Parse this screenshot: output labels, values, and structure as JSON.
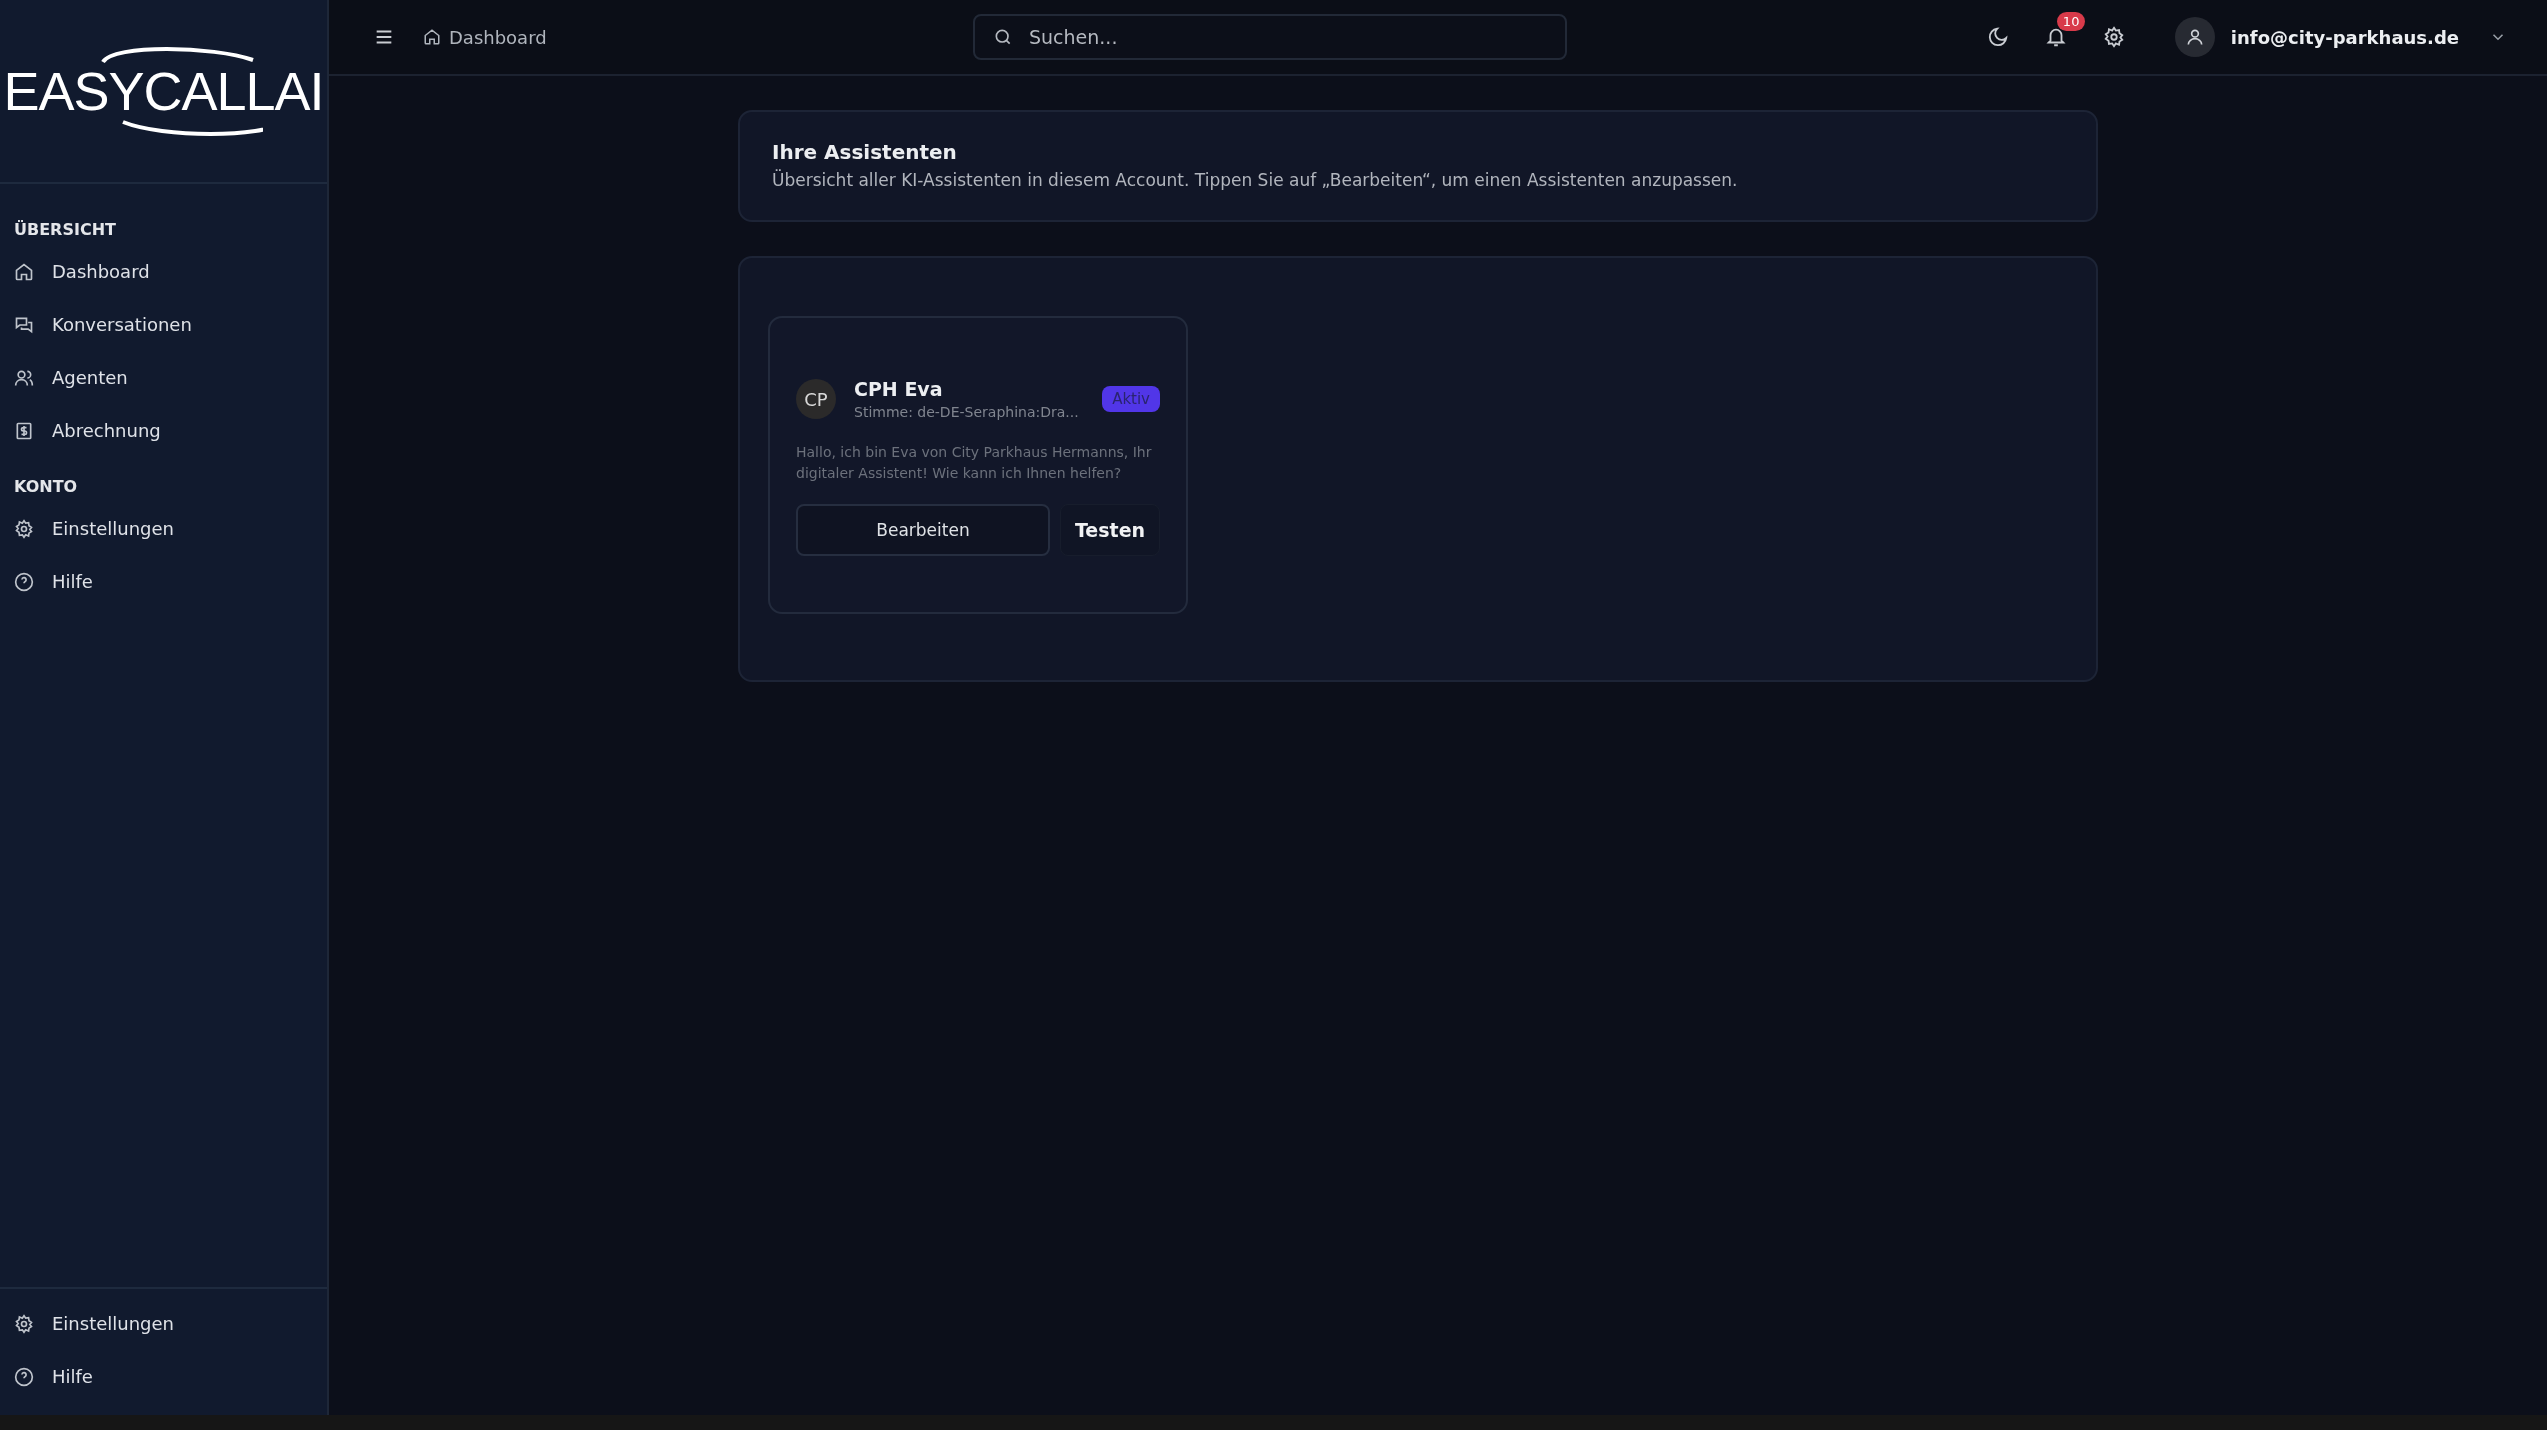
{
  "logo": {
    "text": "EASYCALLAI"
  },
  "sidebar": {
    "sections": [
      {
        "heading": "ÜBERSICHT",
        "items": [
          {
            "label": "Dashboard",
            "kind": "home"
          },
          {
            "label": "Konversationen",
            "kind": "chat"
          },
          {
            "label": "Agenten",
            "kind": "users"
          },
          {
            "label": "Abrechnung",
            "kind": "billing"
          }
        ]
      },
      {
        "heading": "KONTO",
        "items": [
          {
            "label": "Einstellungen",
            "kind": "settings"
          },
          {
            "label": "Hilfe",
            "kind": "help"
          }
        ]
      }
    ],
    "footer_items": [
      {
        "label": "Einstellungen",
        "kind": "settings"
      },
      {
        "label": "Hilfe",
        "kind": "help"
      }
    ]
  },
  "topbar": {
    "breadcrumb": "Dashboard",
    "search": {
      "placeholder": "Suchen..."
    },
    "notification_count": "10",
    "user_email": "info@city-parkhaus.de"
  },
  "header": {
    "title": "Ihre Assistenten",
    "description": "Übersicht aller KI-Assistenten in diesem Account. Tippen Sie auf „Bearbeiten“, um einen Assistenten anzupassen."
  },
  "assistants": [
    {
      "initials": "CP",
      "name": "CPH Eva",
      "voice": "Stimme: de-DE-Seraphina:Dra...",
      "status": "Aktiv",
      "active": true,
      "greeting": "Hallo, ich bin Eva von City Parkhaus Hermanns, Ihr digitaler Assistent! Wie kann ich Ihnen helfen?",
      "buttons": [
        "Bearbeiten",
        "Testen"
      ]
    }
  ]
}
